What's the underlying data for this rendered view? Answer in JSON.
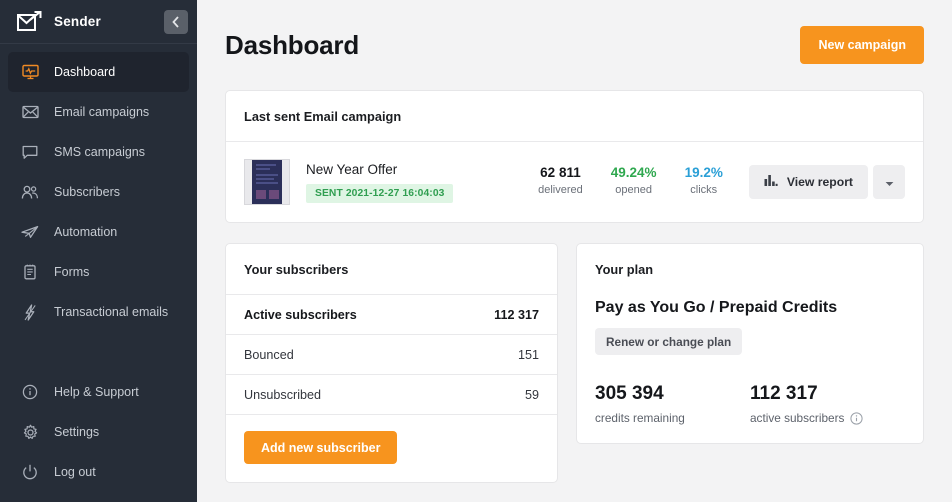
{
  "brand": {
    "name": "Sender",
    "logo_icon": "envelope-arrow-logo",
    "collapse_icon": "chevron-left-icon"
  },
  "sidebar": {
    "items": [
      {
        "label": "Dashboard",
        "icon": "monitor-pulse-icon",
        "active": true
      },
      {
        "label": "Email campaigns",
        "icon": "envelope-icon",
        "active": false
      },
      {
        "label": "SMS campaigns",
        "icon": "chat-bubble-icon",
        "active": false
      },
      {
        "label": "Subscribers",
        "icon": "users-icon",
        "active": false
      },
      {
        "label": "Automation",
        "icon": "paper-plane-icon",
        "active": false
      },
      {
        "label": "Forms",
        "icon": "clipboard-icon",
        "active": false
      },
      {
        "label": "Transactional emails",
        "icon": "lightning-bolt-icon",
        "active": false
      }
    ],
    "bottom_items": [
      {
        "label": "Help & Support",
        "icon": "info-circle-icon"
      },
      {
        "label": "Settings",
        "icon": "gear-icon"
      },
      {
        "label": "Log out",
        "icon": "power-icon"
      }
    ]
  },
  "header": {
    "title": "Dashboard",
    "new_campaign_label": "New campaign"
  },
  "last_campaign": {
    "card_title": "Last sent Email campaign",
    "name": "New Year Offer",
    "status_badge": "SENT 2021-12-27 16:04:03",
    "thumbnail_icon": "email-template-thumbnail",
    "stats": [
      {
        "value": "62 811",
        "label": "delivered",
        "color": "#15171b"
      },
      {
        "value": "49.24%",
        "label": "opened",
        "color": "#2fa84f"
      },
      {
        "value": "19.2%",
        "label": "clicks",
        "color": "#2a9fd6"
      }
    ],
    "view_report_label": "View report",
    "view_report_icon": "bar-chart-icon",
    "dropdown_icon": "caret-down-icon"
  },
  "subscribers": {
    "card_title": "Your subscribers",
    "rows": [
      {
        "label": "Active subscribers",
        "value": "112 317",
        "bold": true
      },
      {
        "label": "Bounced",
        "value": "151",
        "bold": false
      },
      {
        "label": "Unsubscribed",
        "value": "59",
        "bold": false
      }
    ],
    "add_button_label": "Add new subscriber"
  },
  "plan": {
    "card_title": "Your plan",
    "plan_name": "Pay as You Go / Prepaid Credits",
    "renew_button_label": "Renew or change plan",
    "stats": [
      {
        "value": "305 394",
        "label": "credits remaining",
        "info": false
      },
      {
        "value": "112 317",
        "label": "active subscribers",
        "info": true
      }
    ],
    "info_icon": "info-circle-icon"
  },
  "colors": {
    "accent": "#f7941e",
    "sidebar_bg": "#262d38",
    "sidebar_active_bg": "#1f242e",
    "page_bg": "#f3f3f4",
    "green": "#2fa84f",
    "blue": "#2a9fd6"
  }
}
